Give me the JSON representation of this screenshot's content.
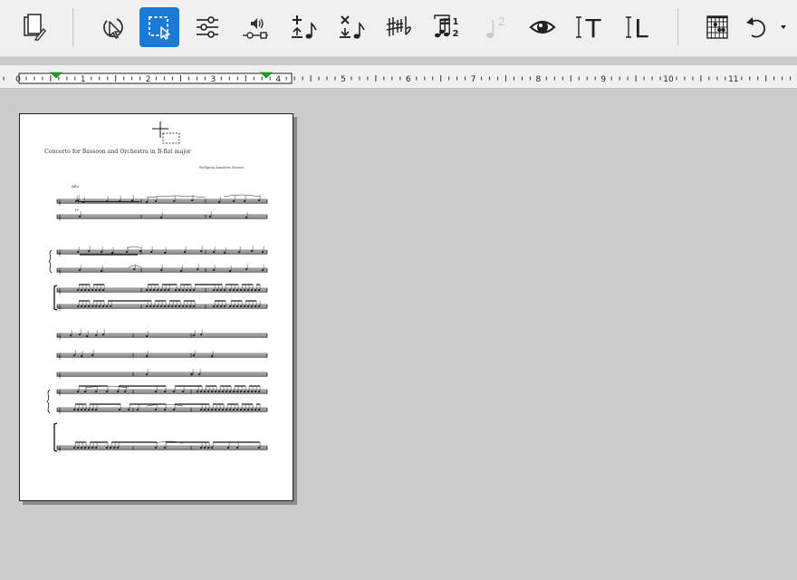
{
  "toolbar": {
    "buttons": [
      {
        "name": "page-setup-button",
        "icon": "page-setup-icon",
        "active": false
      },
      {
        "name": "select-arrow-button",
        "icon": "arrow-cursor-icon",
        "active": false
      },
      {
        "name": "select-box-button",
        "icon": "marquee-select-icon",
        "active": true
      },
      {
        "name": "adjust-button",
        "icon": "sliders-icon",
        "active": false
      },
      {
        "name": "playback-button",
        "icon": "speaker-icon",
        "active": false
      },
      {
        "name": "add-note-button",
        "icon": "add-note-icon",
        "active": false
      },
      {
        "name": "delete-note-button",
        "icon": "delete-note-icon",
        "active": false
      },
      {
        "name": "accidentals-button",
        "icon": "sharp-flat-icon",
        "active": false
      },
      {
        "name": "tuplet-button",
        "icon": "tuplet-icon",
        "active": false
      },
      {
        "name": "second-voice-button",
        "icon": "voice-icon",
        "active": false,
        "disabled": true
      },
      {
        "name": "view-button",
        "icon": "eye-icon",
        "active": false
      },
      {
        "name": "text-tool-button",
        "icon": "text-cursor-icon",
        "active": false
      },
      {
        "name": "lyrics-tool-button",
        "icon": "lyrics-cursor-icon",
        "active": false
      },
      {
        "name": "chord-diagram-button",
        "icon": "chord-grid-icon",
        "active": false
      },
      {
        "name": "undo-button",
        "icon": "undo-icon",
        "active": false
      },
      {
        "name": "undo-dropdown-button",
        "icon": "chevron-down-icon",
        "active": false
      }
    ],
    "accent_color": "#1a7ad4",
    "voice_icon_label": "2",
    "text_tool_glyph": "T",
    "lyrics_tool_glyph": "L"
  },
  "ruler": {
    "labels": [
      "0",
      "1",
      "2",
      "3",
      "4",
      "5",
      "6",
      "7",
      "8",
      "9",
      "10",
      "11",
      "1"
    ],
    "margin_marker_color": "#1aa31a"
  },
  "score": {
    "title": "Concerto for Bassoon and Orchestra in B-flat major",
    "composer": "Wolfgang Amadeus Mozart",
    "tempo": "Allo",
    "dynamic": "tr"
  }
}
